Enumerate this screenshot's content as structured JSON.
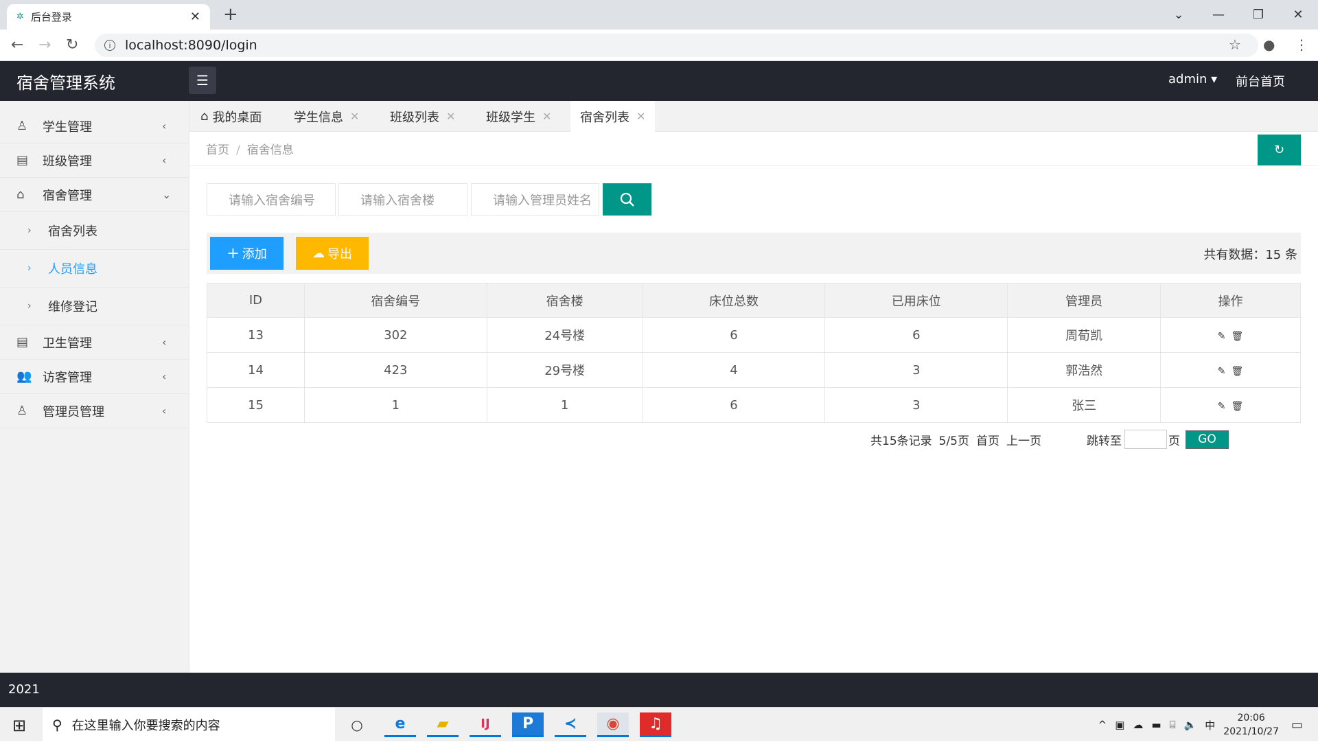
{
  "browser": {
    "tab_title": "后台登录",
    "url": "localhost:8090/login"
  },
  "header": {
    "logo": "宿舍管理系统",
    "user": "admin",
    "front_home": "前台首页"
  },
  "sidebar": {
    "items": [
      {
        "label": "学生管理"
      },
      {
        "label": "班级管理"
      },
      {
        "label": "宿舍管理"
      },
      {
        "label": "卫生管理"
      },
      {
        "label": "访客管理"
      },
      {
        "label": "管理员管理"
      }
    ],
    "sub_items": [
      {
        "label": "宿舍列表"
      },
      {
        "label": "人员信息"
      },
      {
        "label": "维修登记"
      }
    ]
  },
  "tabs": [
    {
      "label": "我的桌面"
    },
    {
      "label": "学生信息"
    },
    {
      "label": "班级列表"
    },
    {
      "label": "班级学生"
    },
    {
      "label": "宿舍列表"
    }
  ],
  "breadcrumb": {
    "home": "首页",
    "current": "宿舍信息"
  },
  "search": {
    "dorm_no_placeholder": "请输入宿舍编号",
    "building_placeholder": "请输入宿舍楼",
    "manager_placeholder": "请输入管理员姓名"
  },
  "toolbar": {
    "add_label": "添加",
    "export_label": "导出",
    "total_label": "共有数据：15 条"
  },
  "table": {
    "headers": [
      "ID",
      "宿舍编号",
      "宿舍楼",
      "床位总数",
      "已用床位",
      "管理员",
      "操作"
    ],
    "rows": [
      [
        "13",
        "302",
        "24号楼",
        "6",
        "6",
        "周荀凯"
      ],
      [
        "14",
        "423",
        "29号楼",
        "4",
        "3",
        "郭浩然"
      ],
      [
        "15",
        "1",
        "1",
        "6",
        "3",
        "张三"
      ]
    ]
  },
  "pager": {
    "total": "共15条记录",
    "pages": "5/5页",
    "first": "首页",
    "prev": "上一页",
    "jump_label": "跳转至",
    "page_unit": "页",
    "go": "GO"
  },
  "footer": {
    "text": "2021"
  },
  "taskbar": {
    "search_placeholder": "在这里输入你要搜索的内容",
    "time": "20:06",
    "date": "2021/10/27",
    "ime": "中"
  }
}
